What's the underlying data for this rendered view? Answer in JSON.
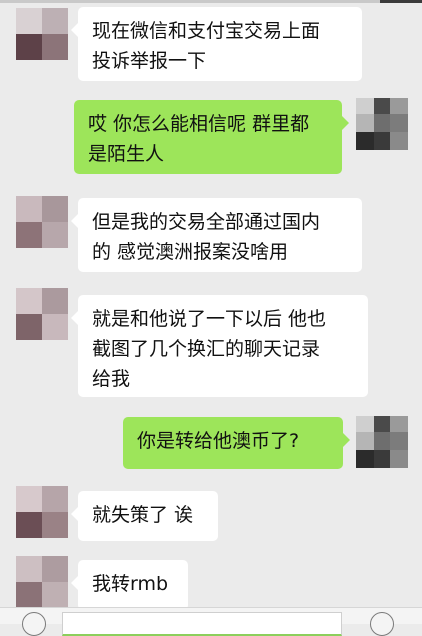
{
  "messages": [
    {
      "side": "left",
      "text": "现在微信和支付宝交易上面\n投诉举报一下",
      "avatar": "contact-avatar"
    },
    {
      "side": "right",
      "text": "哎 你怎么能相信呢 群里都\n是陌生人",
      "avatar": "self-avatar"
    },
    {
      "side": "left",
      "text": "但是我的交易全部通过国内\n的 感觉澳洲报案没啥用",
      "avatar": "contact-avatar"
    },
    {
      "side": "left",
      "text": "就是和他说了一下以后 他也\n截图了几个换汇的聊天记录\n给我",
      "avatar": "contact-avatar"
    },
    {
      "side": "right",
      "text": "你是转给他澳币了?",
      "avatar": "self-avatar"
    },
    {
      "side": "left",
      "text": "就失策了 诶",
      "avatar": "contact-avatar"
    },
    {
      "side": "left",
      "text": "我转rmb",
      "avatar": "contact-avatar"
    }
  ],
  "colors": {
    "background": "#ebebeb",
    "bubble_left": "#ffffff",
    "bubble_right": "#9de55a",
    "text": "#111111"
  },
  "bottom_bar": {
    "left_icon": "voice-icon",
    "right_icon": "emoji-icon"
  }
}
